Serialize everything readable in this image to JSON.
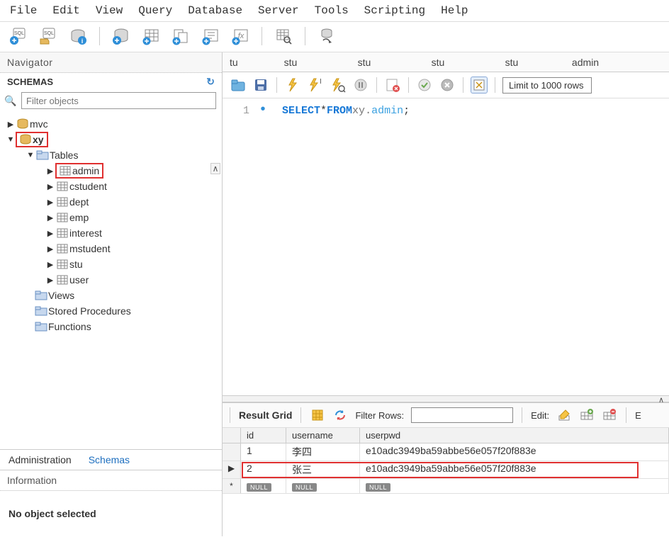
{
  "menu": [
    "File",
    "Edit",
    "View",
    "Query",
    "Database",
    "Server",
    "Tools",
    "Scripting",
    "Help"
  ],
  "sidebar": {
    "nav_title": "Navigator",
    "schemas_label": "SCHEMAS",
    "filter_placeholder": "Filter objects",
    "dbs": {
      "mvc": "mvc",
      "xy": "xy"
    },
    "tables_label": "Tables",
    "tables": [
      "admin",
      "cstudent",
      "dept",
      "emp",
      "interest",
      "mstudent",
      "stu",
      "user"
    ],
    "views_label": "Views",
    "sp_label": "Stored Procedures",
    "fn_label": "Functions",
    "tab_admin": "Administration",
    "tab_schemas": "Schemas",
    "info_title": "Information",
    "info_body": "No object selected"
  },
  "tabs": [
    "tu",
    "stu",
    "stu",
    "stu",
    "stu",
    "admin"
  ],
  "limit_label": "Limit to 1000 rows",
  "sql": {
    "line_no": "1",
    "select": "SELECT",
    "star_from": " * ",
    "from": "FROM",
    "schema": " xy",
    "dot": ".",
    "table": "admin",
    "semi": ";"
  },
  "result": {
    "grid_label": "Result Grid",
    "filter_label": "Filter Rows:",
    "edit_label": "Edit:",
    "export_label": "E",
    "cols": {
      "id": "id",
      "username": "username",
      "userpwd": "userpwd"
    },
    "rows": [
      {
        "id": "1",
        "username": "李四",
        "userpwd": "e10adc3949ba59abbe56e057f20f883e"
      },
      {
        "id": "2",
        "username": "张三",
        "userpwd": "e10adc3949ba59abbe56e057f20f883e"
      }
    ],
    "null": "NULL"
  }
}
